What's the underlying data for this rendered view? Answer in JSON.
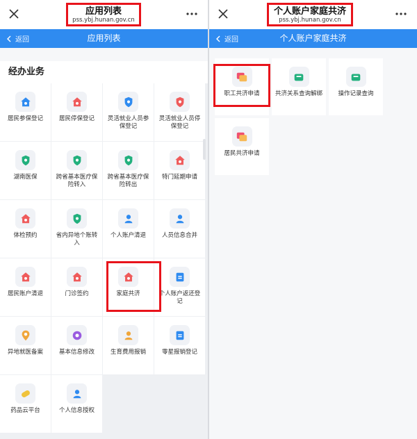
{
  "left": {
    "title": "应用列表",
    "url": "pss.ybj.hunan.gov.cn",
    "back_label": "返回",
    "nav_title": "应用列表",
    "section_title": "经办业务",
    "items": [
      {
        "label": "居民参保登记",
        "icon": "house-icon",
        "color": "#2f8bf0"
      },
      {
        "label": "居民停保登记",
        "icon": "house-pause-icon",
        "color": "#ef5b5b"
      },
      {
        "label": "灵活就业人员参保登记",
        "icon": "shield-user-icon",
        "color": "#2f8bf0"
      },
      {
        "label": "灵活就业人员停保登记",
        "icon": "shield-pause-icon",
        "color": "#ef5b5b"
      },
      {
        "label": "湖南医保",
        "icon": "shield-check-icon",
        "color": "#22b07d"
      },
      {
        "label": "跨省基本医疗保险转入",
        "icon": "transfer-in-icon",
        "color": "#22b07d"
      },
      {
        "label": "跨省基本医疗保险转出",
        "icon": "transfer-out-icon",
        "color": "#22b07d"
      },
      {
        "label": "特门延期申请",
        "icon": "house-clock-icon",
        "color": "#ef5b5b"
      },
      {
        "label": "体检预约",
        "icon": "house-heart-icon",
        "color": "#ef5b5b"
      },
      {
        "label": "省内异地个账转入",
        "icon": "transfer-icon",
        "color": "#22b07d"
      },
      {
        "label": "个人账户清退",
        "icon": "user-refund-icon",
        "color": "#2f8bf0"
      },
      {
        "label": "人员信息合并",
        "icon": "user-merge-icon",
        "color": "#2f8bf0"
      },
      {
        "label": "居民账户清退",
        "icon": "house-refund-icon",
        "color": "#ef5b5b"
      },
      {
        "label": "门诊签约",
        "icon": "house-sign-icon",
        "color": "#ef5b5b"
      },
      {
        "label": "家庭共济",
        "icon": "family-house-icon",
        "color": "#ef5b5b"
      },
      {
        "label": "个人账户返还登记",
        "icon": "yen-icon",
        "color": "#2f8bf0"
      },
      {
        "label": "异地就医备案",
        "icon": "location-icon",
        "color": "#f0a63b"
      },
      {
        "label": "基本信息修改",
        "icon": "settings-icon",
        "color": "#9a5be0"
      },
      {
        "label": "生育费用报销",
        "icon": "baby-icon",
        "color": "#f0a63b"
      },
      {
        "label": "零星报销登记",
        "icon": "clipboard-icon",
        "color": "#2f8bf0"
      },
      {
        "label": "药品云平台",
        "icon": "pill-icon",
        "color": "#f0c33b"
      },
      {
        "label": "个人信息授权",
        "icon": "user-key-icon",
        "color": "#2f8bf0"
      }
    ]
  },
  "right": {
    "title": "个人账户家庭共济",
    "url": "pss.ybj.hunan.gov.cn",
    "back_label": "返回",
    "nav_title": "个人账户家庭共济",
    "items": [
      {
        "label": "职工共济申请",
        "icon": "cards-icon",
        "color": "#f0506e"
      },
      {
        "label": "共济关系查询解绑",
        "icon": "wallet-icon",
        "color": "#22b07d"
      },
      {
        "label": "操作记录查询",
        "icon": "wallet-search-icon",
        "color": "#22b07d"
      },
      {
        "label": "居民共济申请",
        "icon": "cards-icon",
        "color": "#f0506e"
      }
    ]
  },
  "colors": {
    "accent": "#2f8bf0",
    "highlight": "#e8131b"
  }
}
